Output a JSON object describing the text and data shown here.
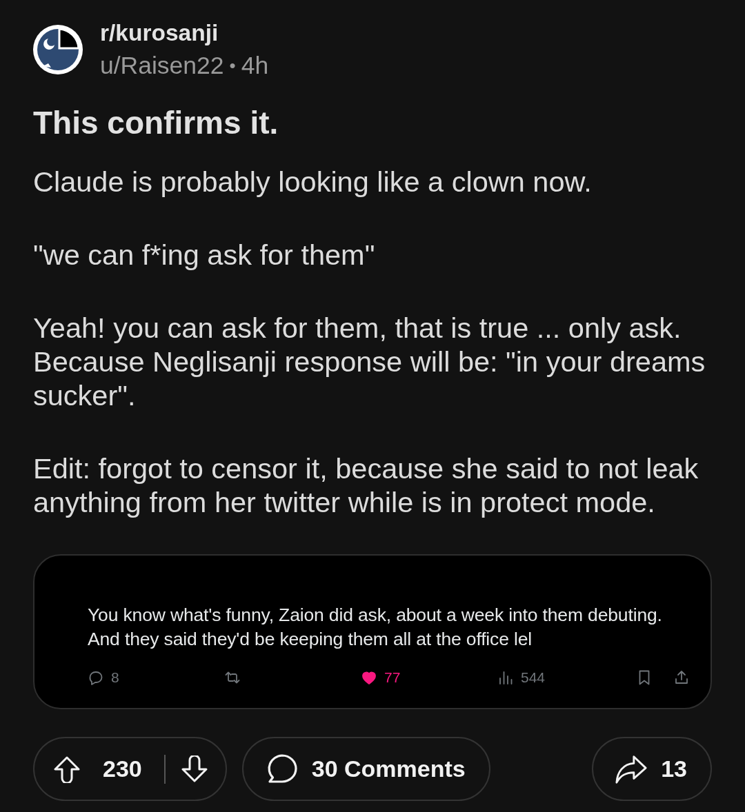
{
  "post": {
    "community": "r/kurosanji",
    "author": "u/Raisen22",
    "separator": "•",
    "age": "4h",
    "title": "This confirms it.",
    "body": [
      "Claude is probably looking like a clown now.",
      "\"we can f*ing ask for them\"",
      "Yeah! you can ask for them, that is true ... only ask. Because Neglisanji response will be: \"in your dreams sucker\".",
      "Edit: forgot to censor it, because she said to not leak anything from her twitter while is in protect mode."
    ]
  },
  "embed": {
    "text": "You know what's funny, Zaion did ask, about a week into them debuting.\nAnd they said they'd be keeping them all at the office lel",
    "actions": [
      {
        "kind": "reply",
        "count": "8",
        "active": false
      },
      {
        "kind": "repost",
        "active": false
      },
      {
        "kind": "like",
        "count": "77",
        "active": true
      },
      {
        "kind": "views",
        "count": "544"
      },
      {
        "kind": "bookmark",
        "active": false
      },
      {
        "kind": "share"
      }
    ]
  },
  "footer": {
    "score": "230",
    "comments": "30 Comments",
    "shares": "13"
  }
}
